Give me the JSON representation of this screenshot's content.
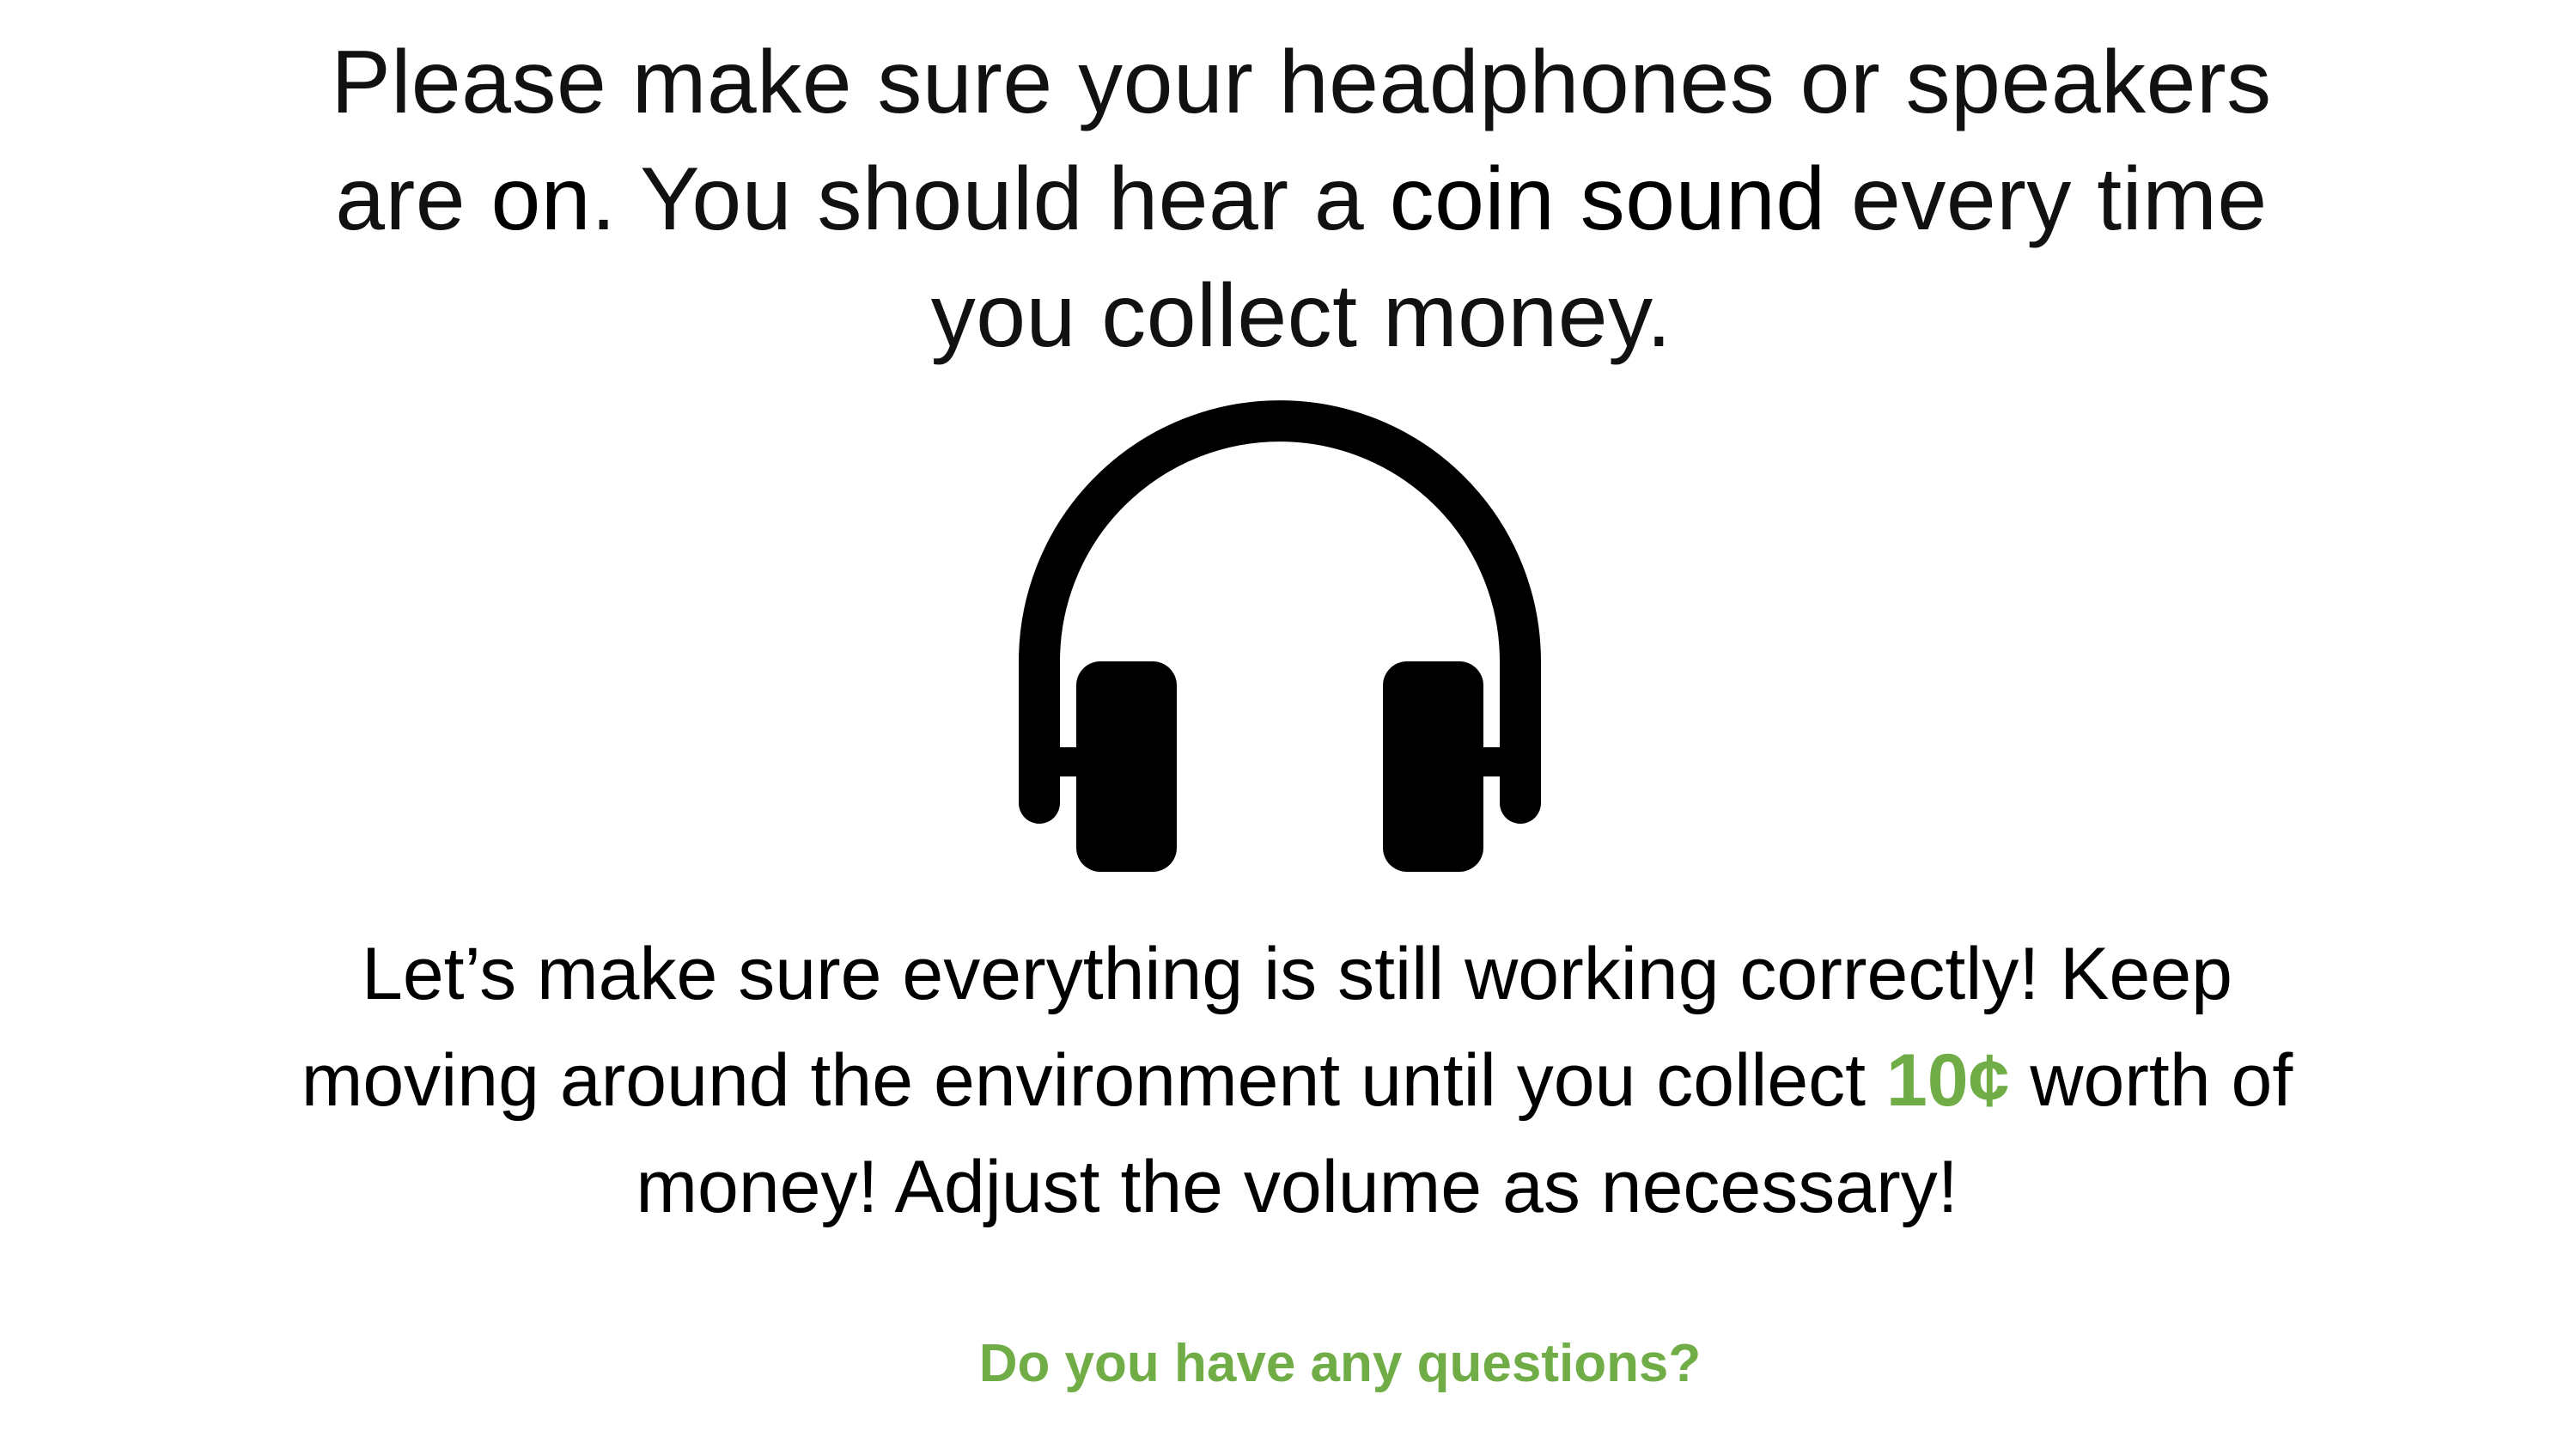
{
  "instruction_top": {
    "line1": "Please make sure your headphones or speakers",
    "line2_pre": "are ",
    "line2_bold1": "on",
    "line2_mid": ". You should hear a ",
    "line2_bold2": "coin sound",
    "line2_post": " every time",
    "line3": "you collect money."
  },
  "icon": {
    "name": "headphones-icon",
    "color": "#000000"
  },
  "instruction_bottom": {
    "line1": "Let’s make sure everything is still working correctly! Keep",
    "line2_pre": "moving around the environment until you collect ",
    "line2_amount": "10¢",
    "line2_post": " worth of",
    "line3": "money! Adjust the volume as necessary!"
  },
  "question": "Do you have any questions?",
  "colors": {
    "accent": "#70ad47",
    "text": "#000000",
    "background": "#ffffff"
  }
}
